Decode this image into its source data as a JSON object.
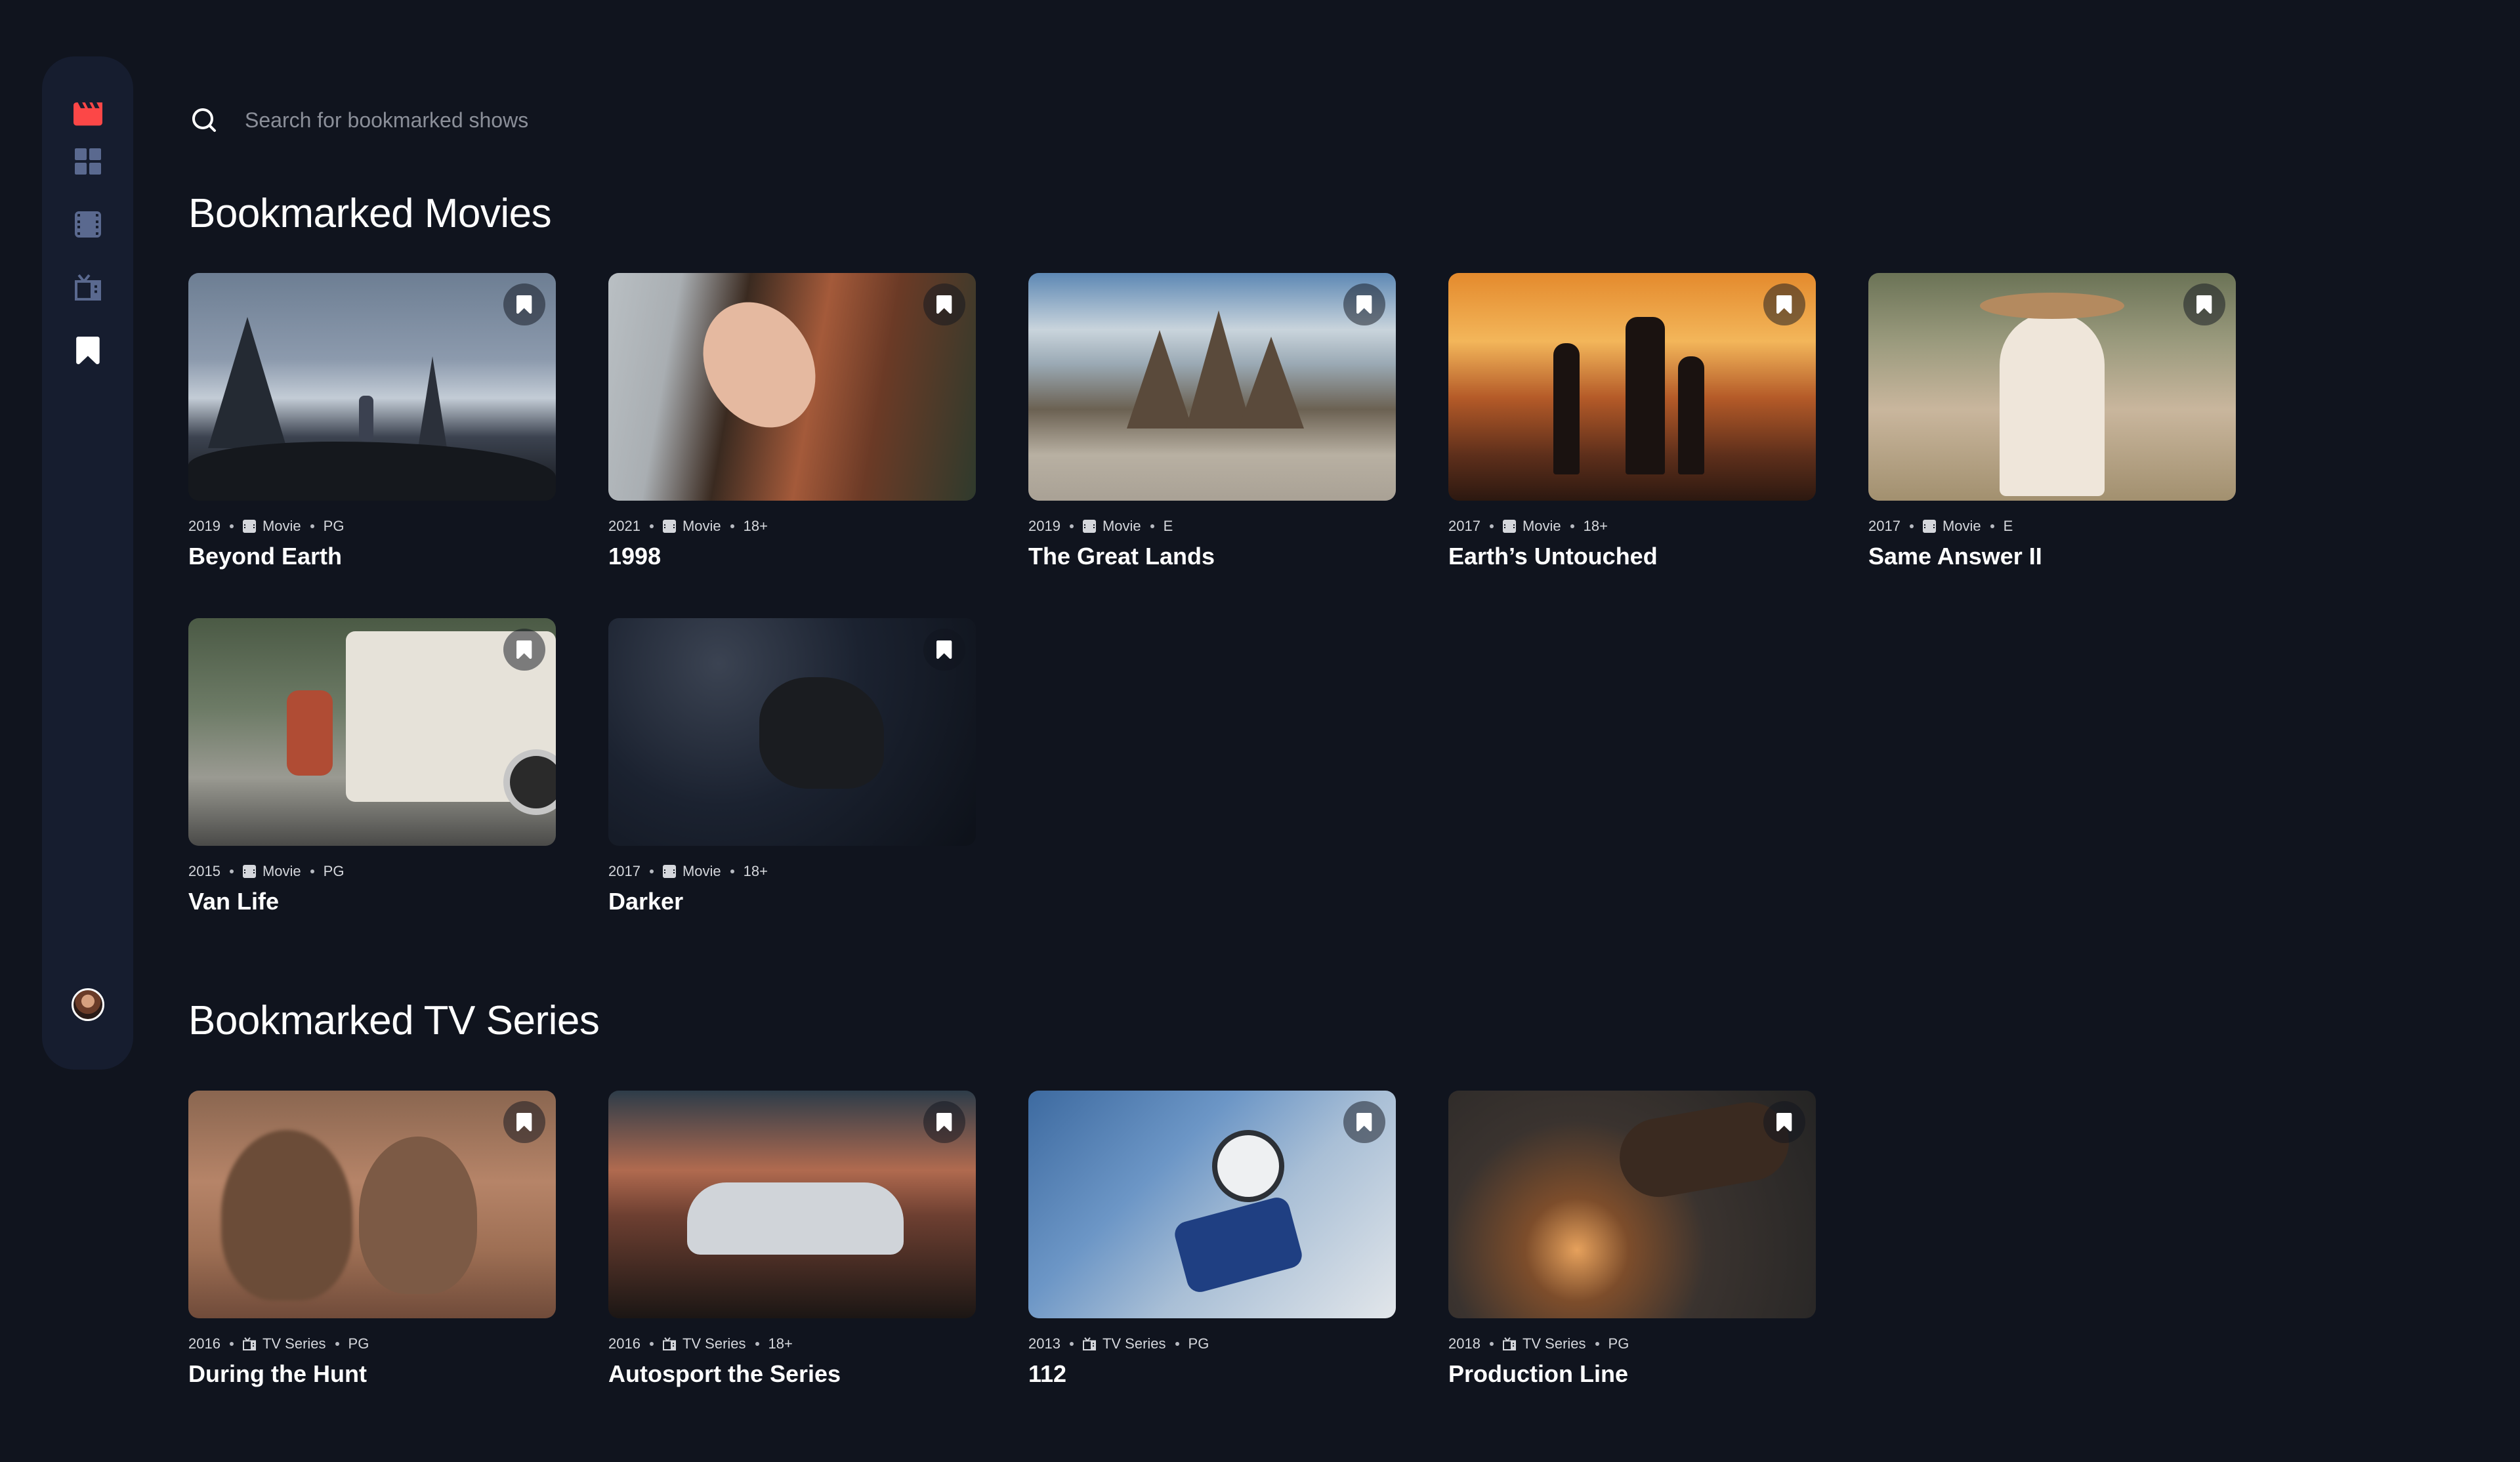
{
  "sidebar": {
    "logo_icon": "clapperboard-logo-icon",
    "nav": [
      {
        "name": "home-grid-icon",
        "label": ""
      },
      {
        "name": "movies-icon",
        "label": ""
      },
      {
        "name": "tv-series-icon",
        "label": ""
      },
      {
        "name": "bookmark-nav-icon",
        "label": ""
      }
    ],
    "accent_color": "#fc4747",
    "inactive_color": "#5a698f",
    "active_color": "#ffffff"
  },
  "search": {
    "placeholder": "Search for bookmarked shows"
  },
  "sections": {
    "movies_title": "Bookmarked Movies",
    "tv_title": "Bookmarked TV Series"
  },
  "movies": [
    {
      "year": "2019",
      "category": "Movie",
      "rating": "PG",
      "title": "Beyond Earth"
    },
    {
      "year": "2021",
      "category": "Movie",
      "rating": "18+",
      "title": "1998"
    },
    {
      "year": "2019",
      "category": "Movie",
      "rating": "E",
      "title": "The Great Lands"
    },
    {
      "year": "2017",
      "category": "Movie",
      "rating": "18+",
      "title": "Earth’s Untouched"
    },
    {
      "year": "2017",
      "category": "Movie",
      "rating": "E",
      "title": "Same Answer II"
    },
    {
      "year": "2015",
      "category": "Movie",
      "rating": "PG",
      "title": "Van Life"
    },
    {
      "year": "2017",
      "category": "Movie",
      "rating": "18+",
      "title": "Darker"
    }
  ],
  "tv_series": [
    {
      "year": "2016",
      "category": "TV Series",
      "rating": "PG",
      "title": "During the Hunt"
    },
    {
      "year": "2016",
      "category": "TV Series",
      "rating": "18+",
      "title": "Autosport the Series"
    },
    {
      "year": "2013",
      "category": "TV Series",
      "rating": "PG",
      "title": "112"
    },
    {
      "year": "2018",
      "category": "TV Series",
      "rating": "PG",
      "title": "Production Line"
    }
  ]
}
